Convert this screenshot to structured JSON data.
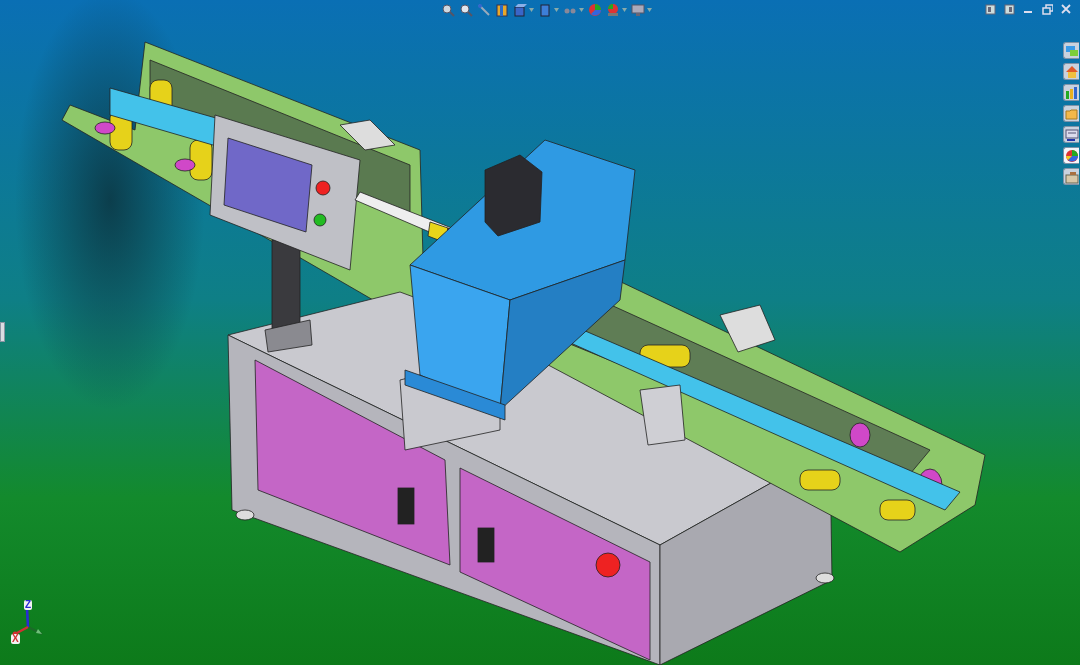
{
  "view_toolbar": {
    "items": [
      {
        "dropdown": false
      },
      {
        "dropdown": false
      },
      {
        "dropdown": false
      },
      {
        "dropdown": false
      },
      {
        "dropdown": true
      },
      {
        "dropdown": true
      },
      {
        "dropdown": true
      },
      {
        "dropdown": false
      },
      {
        "dropdown": true
      },
      {
        "dropdown": true
      }
    ]
  },
  "task_pane": {
    "tabs": [
      {
        "selected": false
      },
      {
        "selected": false
      },
      {
        "selected": false
      },
      {
        "selected": false
      },
      {
        "selected": false
      },
      {
        "selected": true
      },
      {
        "selected": false
      }
    ]
  },
  "triad": {
    "axes": [
      {
        "label": "Z",
        "color": "#2a2ad6"
      },
      {
        "label": "X",
        "color": "#d03030"
      }
    ]
  }
}
